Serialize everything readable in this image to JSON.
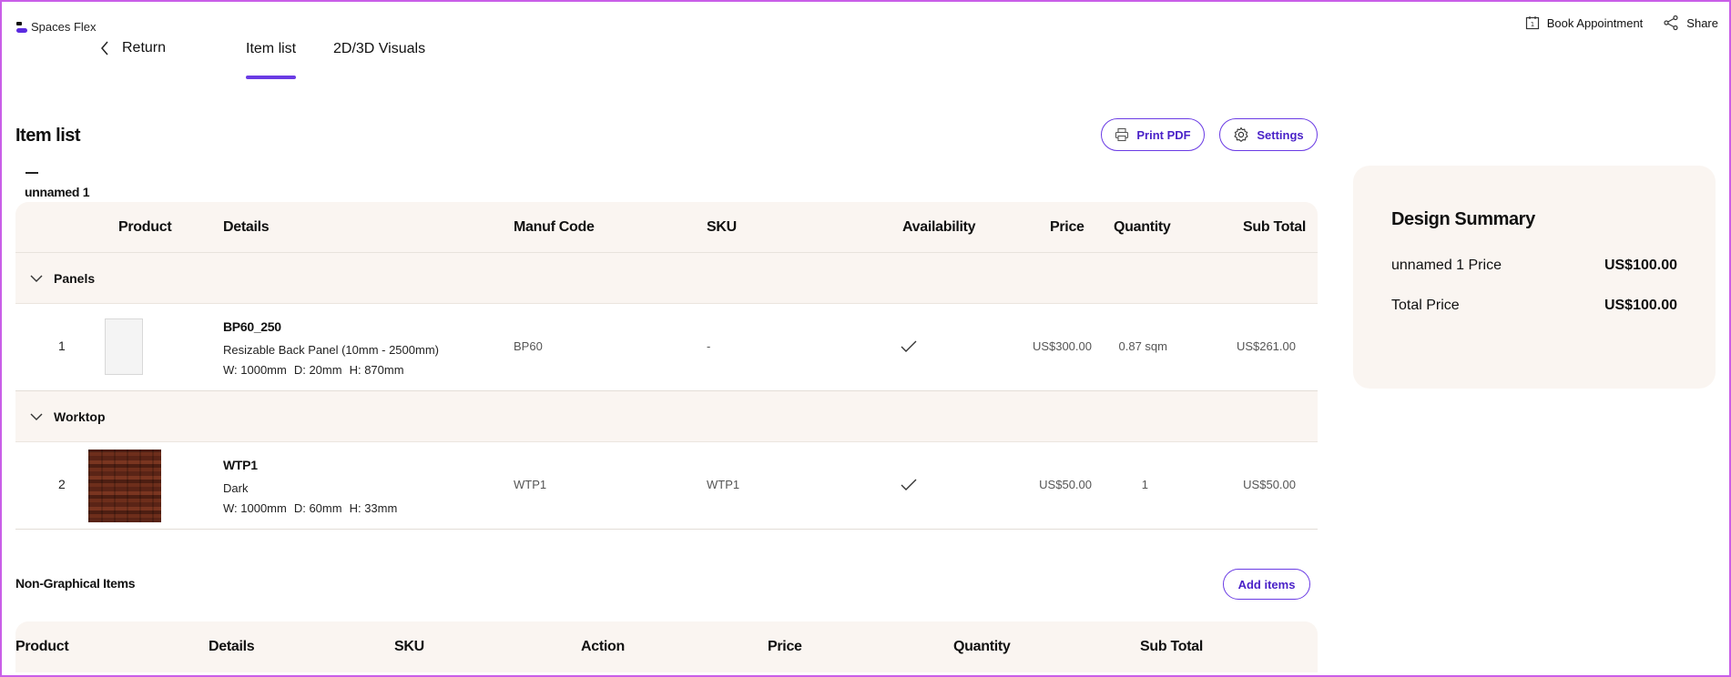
{
  "app": {
    "brand": "Spaces Flex"
  },
  "nav": {
    "return_label": "Return",
    "tabs": [
      {
        "label": "Item list",
        "active": true
      },
      {
        "label": "2D/3D Visuals",
        "active": false
      }
    ]
  },
  "top_actions": {
    "book_label": "Book Appointment",
    "share_label": "Share"
  },
  "item_list": {
    "title": "Item list",
    "print_label": "Print PDF",
    "settings_label": "Settings",
    "group_name": "unnamed 1",
    "columns": [
      "Product",
      "Details",
      "Manuf Code",
      "SKU",
      "Availability",
      "Price",
      "Quantity",
      "Sub Total"
    ],
    "categories": [
      {
        "name": "Panels",
        "items": [
          {
            "num": "1",
            "name": "BP60_250",
            "desc": "Resizable Back Panel (10mm - 2500mm)",
            "dims": [
              "W: 1000mm",
              "D: 20mm",
              "H: 870mm"
            ],
            "manuf_code": "BP60",
            "sku": "-",
            "available": true,
            "price": "US$300.00",
            "quantity": "0.87 sqm",
            "subtotal": "US$261.00",
            "thumb": "blank-panel"
          }
        ]
      },
      {
        "name": "Worktop",
        "items": [
          {
            "num": "2",
            "name": "WTP1",
            "desc": "Dark",
            "dims": [
              "W: 1000mm",
              "D: 60mm",
              "H: 33mm"
            ],
            "manuf_code": "WTP1",
            "sku": "WTP1",
            "available": true,
            "price": "US$50.00",
            "quantity": "1",
            "subtotal": "US$50.00",
            "thumb": "dark-wood"
          }
        ]
      }
    ]
  },
  "summary": {
    "title": "Design Summary",
    "rows": [
      {
        "label": "unnamed 1 Price",
        "value": "US$100.00"
      },
      {
        "label": "Total Price",
        "value": "US$100.00"
      }
    ]
  },
  "non_graphical": {
    "title": "Non-Graphical Items",
    "add_label": "Add items",
    "columns": [
      "Product",
      "Details",
      "SKU",
      "Action",
      "Price",
      "Quantity",
      "Sub Total"
    ]
  },
  "colors": {
    "accent": "#6a3be4",
    "panel_bg": "#faf5f1",
    "frame": "#c95ee8"
  },
  "icons": {
    "return": "chevron-left-icon",
    "category_toggle": "chevron-down-icon",
    "book": "calendar-icon",
    "share": "share-icon",
    "print": "printer-icon",
    "settings": "gear-icon",
    "availability": "check-icon"
  }
}
